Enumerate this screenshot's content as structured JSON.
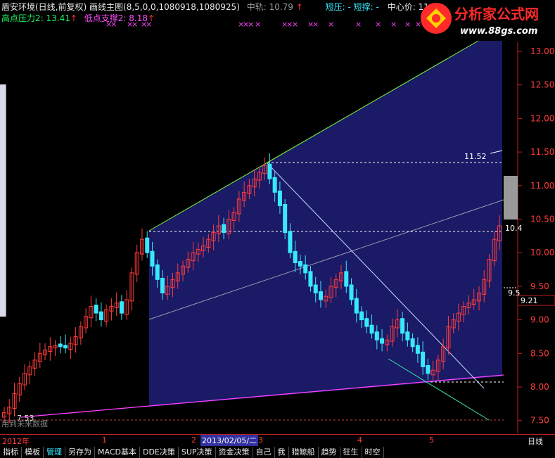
{
  "header": {
    "stock_title": "盾安环境(日线,前复权)",
    "indicator": "画线主图(8,5,0,0,1080918,1080925)",
    "mid_rail": "中轨: 10.79",
    "short_press": "短压: - 短撑: -",
    "center_price": "中心价: 11.43",
    "high_press_label": "高点压力2: 13.41",
    "low_support_label": "低点支撑2: 8.18"
  },
  "logo": {
    "title": "分析家公式网",
    "url": "www.88gs.com"
  },
  "y_axis": {
    "ticks": [
      "13.00",
      "12.50",
      "12.00",
      "11.50",
      "11.00",
      "10.50",
      "10.00",
      "9.50",
      "9.00",
      "8.50",
      "8.00",
      "7.50"
    ],
    "current_price": "9.21"
  },
  "annotations": {
    "price_1152": "11.52",
    "price_104": "10.4",
    "price_95": "9.5",
    "price_753": "7.53",
    "future_data": "用到未来数据"
  },
  "x_axis": {
    "labels": [
      "2012年",
      "1",
      "2",
      "2013/02/05/二",
      "3",
      "4",
      "5"
    ],
    "period": "日线"
  },
  "tabs": [
    "指标",
    "模板",
    "管理",
    "另存为",
    "MACD基本",
    "DDE决策",
    "SUP决策",
    "资金决策",
    "自己",
    "我",
    "猎鲸船",
    "趋势",
    "狂生",
    "时空"
  ],
  "active_tab": "管理",
  "colors": {
    "up": "#ff3c3c",
    "down": "#38e8ff",
    "channel_fill": "#1a1a66",
    "upper_line": "#7fff3a",
    "lower_line": "#ff40ff",
    "mid_line": "#8a8aa0"
  }
}
